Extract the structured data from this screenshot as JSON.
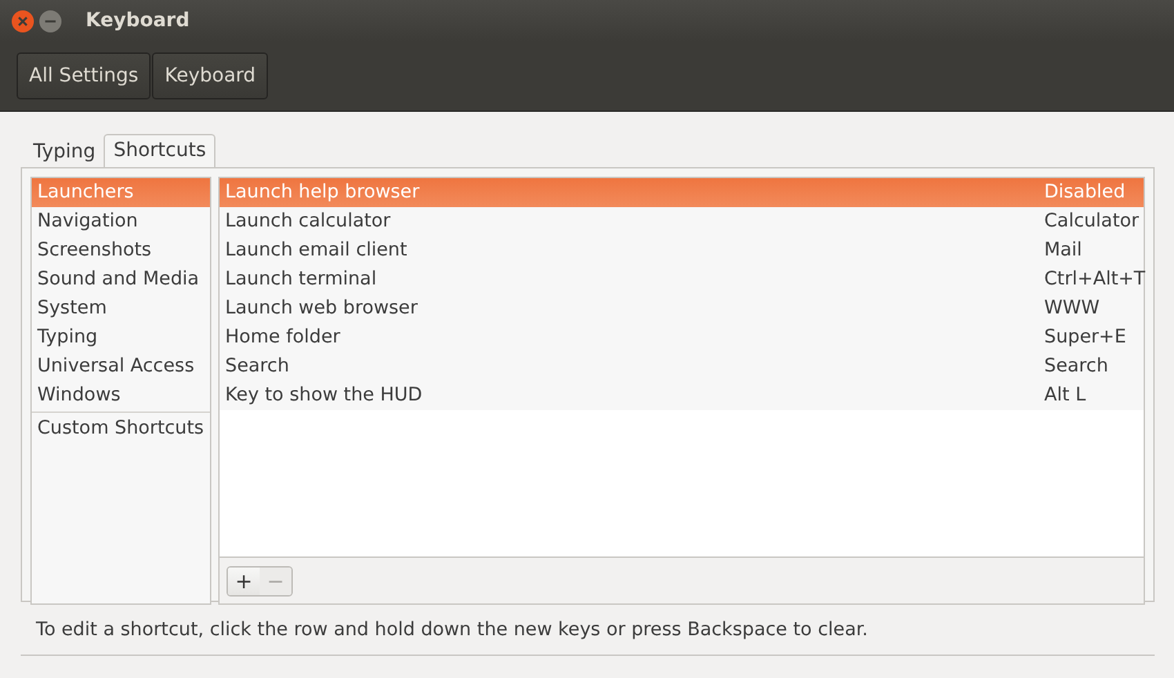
{
  "window": {
    "title": "Keyboard"
  },
  "breadcrumbs": [
    {
      "label": "All Settings"
    },
    {
      "label": "Keyboard"
    }
  ],
  "tabs": [
    {
      "label": "Typing",
      "selected": false
    },
    {
      "label": "Shortcuts",
      "selected": true
    }
  ],
  "categories": [
    {
      "label": "Launchers",
      "selected": true
    },
    {
      "label": "Navigation",
      "selected": false
    },
    {
      "label": "Screenshots",
      "selected": false
    },
    {
      "label": "Sound and Media",
      "selected": false
    },
    {
      "label": "System",
      "selected": false
    },
    {
      "label": "Typing",
      "selected": false
    },
    {
      "label": "Universal Access",
      "selected": false
    },
    {
      "label": "Windows",
      "selected": false
    }
  ],
  "custom_category": {
    "label": "Custom Shortcuts",
    "selected": false
  },
  "shortcuts": [
    {
      "action": "Launch help browser",
      "keys": "Disabled",
      "selected": true
    },
    {
      "action": "Launch calculator",
      "keys": "Calculator",
      "selected": false
    },
    {
      "action": "Launch email client",
      "keys": "Mail",
      "selected": false
    },
    {
      "action": "Launch terminal",
      "keys": "Ctrl+Alt+T",
      "selected": false
    },
    {
      "action": "Launch web browser",
      "keys": "WWW",
      "selected": false
    },
    {
      "action": "Home folder",
      "keys": "Super+E",
      "selected": false
    },
    {
      "action": "Search",
      "keys": "Search",
      "selected": false
    },
    {
      "action": "Key to show the HUD",
      "keys": "Alt L",
      "selected": false
    }
  ],
  "list_buttons": [
    {
      "label": "+",
      "disabled": false
    },
    {
      "label": "−",
      "disabled": true
    }
  ],
  "hint": "To edit a shortcut, click the row and hold down the new keys or press Backspace to clear."
}
